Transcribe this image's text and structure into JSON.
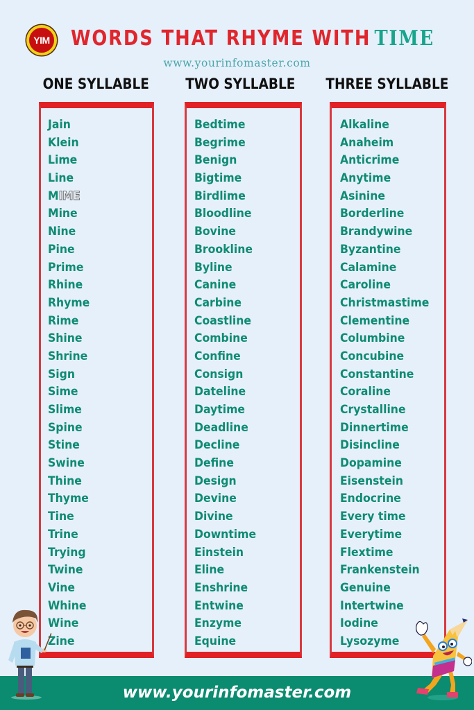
{
  "header": {
    "logo_text": "YIM",
    "title_main": "WORDS THAT RHYME WITH",
    "title_accent": "TIME",
    "subtitle": "www.yourinfomaster.com"
  },
  "colors": {
    "background": "#e6f0fb",
    "title_red": "#e0262d",
    "title_teal": "#17a58c",
    "word_green": "#0e8b73",
    "box_border_red": "#e02226",
    "footer_green": "#0b8b6f"
  },
  "columns": [
    {
      "heading": "ONE SYLLABLE",
      "words": [
        "Jain",
        "Klein",
        "Lime",
        "Line",
        "MIME",
        "Mine",
        "Nine",
        "Pine",
        "Prime",
        "Rhine",
        "Rhyme",
        "Rime",
        "Shine",
        "Shrine",
        "Sign",
        "Sime",
        "Slime",
        "Spine",
        "Stine",
        "Swine",
        "Thine",
        "Thyme",
        "Tine",
        "Trine",
        "Trying",
        "Twine",
        "Vine",
        "Whine",
        "Wine",
        "Zine"
      ]
    },
    {
      "heading": "TWO SYLLABLE",
      "words": [
        "Bedtime",
        "Begrime",
        "Benign",
        "Bigtime",
        "Birdlime",
        "Bloodline",
        "Bovine",
        "Brookline",
        "Byline",
        "Canine",
        "Carbine",
        "Coastline",
        "Combine",
        "Confine",
        "Consign",
        "Dateline",
        "Daytime",
        "Deadline",
        "Decline",
        "Define",
        "Design",
        "Devine",
        "Divine",
        "Downtime",
        "Einstein",
        "Eline",
        "Enshrine",
        "Entwine",
        "Enzyme",
        "Equine"
      ]
    },
    {
      "heading": "THREE SYLLABLE",
      "words": [
        "Alkaline",
        "Anaheim",
        "Anticrime",
        "Anytime",
        "Asinine",
        "Borderline",
        "Brandywine",
        "Byzantine",
        "Calamine",
        "Caroline",
        "Christmastime",
        "Clementine",
        "Columbine",
        "Concubine",
        "Constantine",
        "Coraline",
        "Crystalline",
        "Dinnertime",
        "Disincline",
        "Dopamine",
        "Eisenstein",
        "Endocrine",
        "Every time",
        "Everytime",
        "Flextime",
        "Frankenstein",
        "Genuine",
        "Intertwine",
        "Iodine",
        "Lysozyme"
      ]
    }
  ],
  "footer": {
    "text": "www.yourinfomaster.com"
  },
  "illustrations": {
    "left": "teacher-character-icon",
    "right": "pencil-mascot-icon"
  }
}
